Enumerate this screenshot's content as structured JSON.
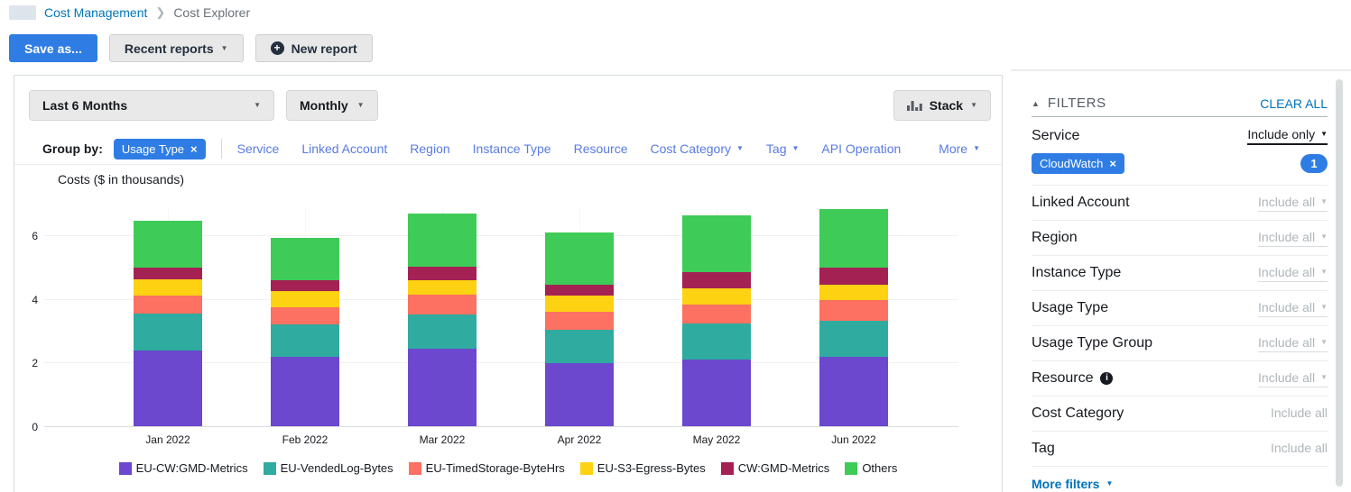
{
  "breadcrumb": {
    "app": "Cost Management",
    "page": "Cost Explorer"
  },
  "actions": {
    "save_as": "Save as...",
    "recent_reports": "Recent reports",
    "new_report": "New report"
  },
  "toolbar": {
    "date_range": "Last 6 Months",
    "granularity": "Monthly",
    "chart_style": "Stack"
  },
  "group_by": {
    "label": "Group by:",
    "chip": "Usage Type",
    "links": [
      {
        "label": "Service",
        "caret": false
      },
      {
        "label": "Linked Account",
        "caret": false
      },
      {
        "label": "Region",
        "caret": false
      },
      {
        "label": "Instance Type",
        "caret": false
      },
      {
        "label": "Resource",
        "caret": false
      },
      {
        "label": "Cost Category",
        "caret": true
      },
      {
        "label": "Tag",
        "caret": true
      },
      {
        "label": "API Operation",
        "caret": false
      }
    ],
    "more": "More"
  },
  "chart_data": {
    "type": "bar",
    "stacked": true,
    "title": "Costs ($ in thousands)",
    "categories": [
      "Jan 2022",
      "Feb 2022",
      "Mar 2022",
      "Apr 2022",
      "May 2022",
      "Jun 2022"
    ],
    "series": [
      {
        "name": "EU-CW:GMD-Metrics",
        "color": "#6b48ce",
        "values": [
          2.38,
          2.18,
          2.44,
          1.98,
          2.1,
          2.18
        ]
      },
      {
        "name": "EU-VendedLog-Bytes",
        "color": "#2fab9f",
        "values": [
          1.17,
          1.02,
          1.07,
          1.05,
          1.13,
          1.13
        ]
      },
      {
        "name": "EU-TimedStorage-ByteHrs",
        "color": "#fc7161",
        "values": [
          0.57,
          0.54,
          0.62,
          0.57,
          0.59,
          0.66
        ]
      },
      {
        "name": "EU-S3-Egress-Bytes",
        "color": "#fdd212",
        "values": [
          0.5,
          0.51,
          0.46,
          0.5,
          0.51,
          0.48
        ]
      },
      {
        "name": "CW:GMD-Metrics",
        "color": "#a42154",
        "values": [
          0.38,
          0.34,
          0.42,
          0.35,
          0.51,
          0.54
        ]
      },
      {
        "name": "Others",
        "color": "#3ecb57",
        "values": [
          1.47,
          1.33,
          1.67,
          1.64,
          1.79,
          1.84
        ]
      }
    ],
    "totals": [
      6.47,
      5.92,
      6.68,
      6.09,
      6.63,
      6.83
    ],
    "yticks": [
      0,
      2,
      4,
      6
    ],
    "ylim": [
      0,
      6.94
    ],
    "grid": true,
    "legend_position": "bottom"
  },
  "filters": {
    "title": "FILTERS",
    "clear_all": "CLEAR ALL",
    "rows": [
      {
        "label": "Service",
        "value": "Include only",
        "active": true,
        "caret": true,
        "chip": "CloudWatch",
        "badge": "1"
      },
      {
        "label": "Linked Account",
        "value": "Include all",
        "caret": true
      },
      {
        "label": "Region",
        "value": "Include all",
        "caret": true
      },
      {
        "label": "Instance Type",
        "value": "Include all",
        "caret": true
      },
      {
        "label": "Usage Type",
        "value": "Include all",
        "caret": true
      },
      {
        "label": "Usage Type Group",
        "value": "Include all",
        "caret": true
      },
      {
        "label": "Resource",
        "value": "Include all",
        "caret": true,
        "info": true
      },
      {
        "label": "Cost Category",
        "value": "Include all",
        "caret": false
      },
      {
        "label": "Tag",
        "value": "Include all",
        "caret": false
      }
    ],
    "more_filters": "More filters"
  },
  "colors": {
    "accent_blue": "#2f7de4",
    "link_blue": "#0073bb",
    "group_link_blue": "#587be2"
  }
}
